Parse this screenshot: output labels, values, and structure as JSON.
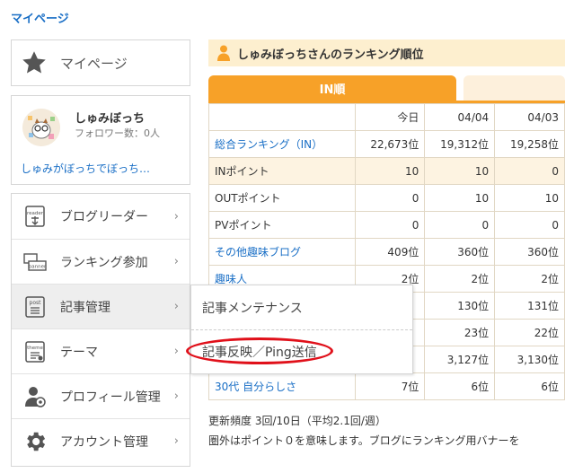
{
  "breadcrumb": "マイページ",
  "sidebar": {
    "mypage_label": "マイページ",
    "profile": {
      "name": "しゅみぼっち",
      "followers": "フォロワー数：0人",
      "tagline": "しゅみがぼっちでぼっち…"
    },
    "menu": [
      {
        "label": "ブログリーダー",
        "icon": "reader-icon"
      },
      {
        "label": "ランキング参加",
        "icon": "banner-icon"
      },
      {
        "label": "記事管理",
        "icon": "post-icon"
      },
      {
        "label": "テーマ",
        "icon": "theme-icon"
      },
      {
        "label": "プロフィール管理",
        "icon": "profile-icon"
      },
      {
        "label": "アカウント管理",
        "icon": "gear-icon"
      }
    ],
    "submenu": [
      "記事メンテナンス",
      "記事反映／Ping送信"
    ]
  },
  "ranking": {
    "title": "しゅみぼっちさんのランキング順位",
    "tab_in": "IN順",
    "columns": [
      "",
      "今日",
      "04/04",
      "04/03"
    ],
    "rows": [
      {
        "name": "総合ランキング（IN）",
        "link": true,
        "hl": false,
        "values": [
          "22,673位",
          "19,312位",
          "19,258位"
        ]
      },
      {
        "name": "INポイント",
        "link": false,
        "hl": true,
        "values": [
          "10",
          "10",
          "0"
        ]
      },
      {
        "name": "OUTポイント",
        "link": false,
        "hl": false,
        "values": [
          "0",
          "10",
          "10"
        ]
      },
      {
        "name": "PVポイント",
        "link": false,
        "hl": false,
        "values": [
          "0",
          "0",
          "0"
        ]
      },
      {
        "name": "その他趣味ブログ",
        "link": true,
        "hl": false,
        "values": [
          "409位",
          "360位",
          "360位"
        ]
      },
      {
        "name": "趣味人",
        "link": true,
        "hl": false,
        "values": [
          "2位",
          "2位",
          "2位"
        ]
      },
      {
        "name": "",
        "link": true,
        "hl": false,
        "values": [
          "",
          "130位",
          "131位"
        ]
      },
      {
        "name": "",
        "link": true,
        "hl": false,
        "values": [
          "",
          "23位",
          "22位"
        ]
      },
      {
        "name": "",
        "link": true,
        "hl": false,
        "values": [
          "",
          "3,127位",
          "3,130位"
        ]
      },
      {
        "name": "30代 自分らしさ",
        "link": true,
        "hl": false,
        "values": [
          "7位",
          "6位",
          "6位"
        ]
      }
    ],
    "note_frequency": "更新頻度 3回/10日（平均2.1回/週）",
    "note_outside": "圏外はポイント０を意味します。ブログにランキング用バナーを"
  },
  "colors": {
    "accent": "#f7a128",
    "link": "#1a6fc6",
    "ring": "#e0101a"
  }
}
